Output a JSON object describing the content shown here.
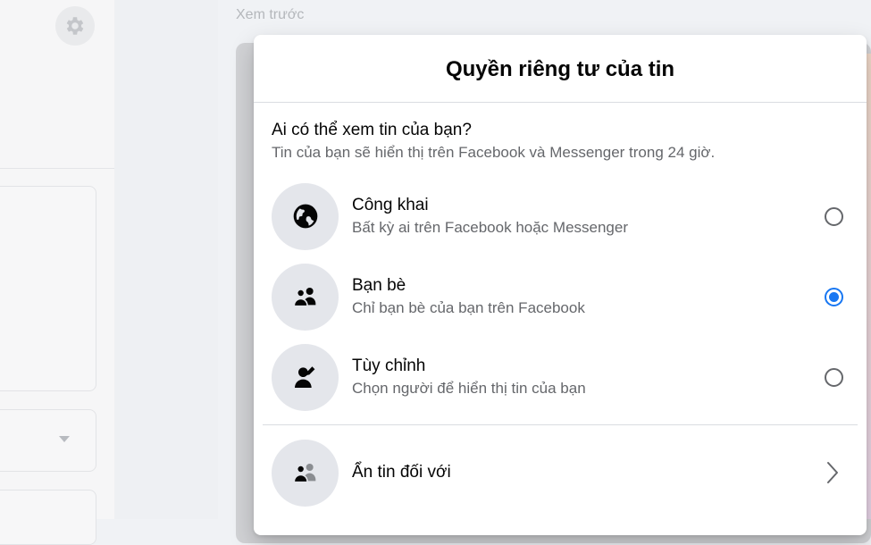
{
  "background": {
    "preview_label": "Xem trước"
  },
  "modal": {
    "title": "Quyền riêng tư của tin",
    "question": "Ai có thể xem tin của bạn?",
    "subtext": "Tin của bạn sẽ hiển thị trên Facebook và Messenger trong 24 giờ.",
    "options": [
      {
        "label": "Công khai",
        "desc": "Bất kỳ ai trên Facebook hoặc Messenger",
        "icon": "globe-icon",
        "selected": false
      },
      {
        "label": "Bạn bè",
        "desc": "Chỉ bạn bè của bạn trên Facebook",
        "icon": "friends-icon",
        "selected": true
      },
      {
        "label": "Tùy chỉnh",
        "desc": "Chọn người để hiển thị tin của bạn",
        "icon": "custom-person-icon",
        "selected": false
      }
    ],
    "hide_story": {
      "label": "Ẩn tin đối với",
      "icon": "hide-friends-icon"
    }
  },
  "colors": {
    "accent": "#1877f2",
    "secondary_text": "#65676b",
    "icon_bg": "#e4e6eb"
  }
}
